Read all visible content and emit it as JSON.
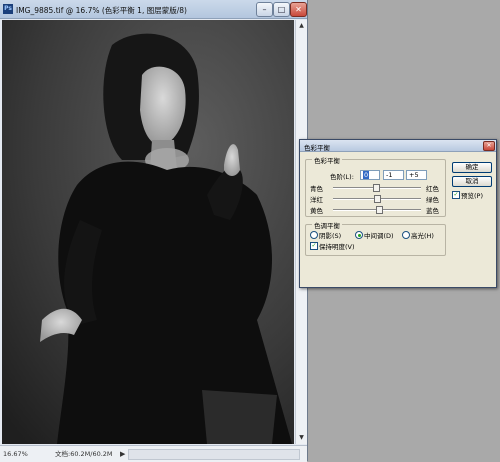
{
  "document": {
    "title": "IMG_9885.tif @ 16.7% (色彩平衡 1, 图层蒙版/8)",
    "app_icon": "Ps",
    "window_buttons": {
      "minimize": "–",
      "maximize": "□",
      "close": "✕"
    },
    "status": {
      "zoom": "16.67%",
      "doc_info": "文档:60.2M/60.2M",
      "nav_arrow": "▶"
    },
    "scroll_arrows": {
      "up": "▲",
      "down": "▼"
    }
  },
  "dialog": {
    "title": "色彩平衡",
    "close": "✕",
    "balance_group": {
      "legend": "色彩平衡",
      "levels_label": "色阶(L):",
      "levels": [
        "0",
        "-1",
        "+5"
      ],
      "sliders": [
        {
          "left": "青色",
          "right": "红色",
          "value": 0
        },
        {
          "left": "洋红",
          "right": "绿色",
          "value": -1
        },
        {
          "left": "黄色",
          "right": "蓝色",
          "value": 5
        }
      ]
    },
    "tone_group": {
      "legend": "色调平衡",
      "options": [
        "阴影(S)",
        "中间调(D)",
        "高光(H)"
      ],
      "selected": "中间调(D)",
      "preserve_label": "保持明度(V)",
      "preserve_checked": true
    },
    "ok": "确定",
    "cancel": "取消",
    "preview_label": "预览(P)",
    "preview_checked": true
  }
}
